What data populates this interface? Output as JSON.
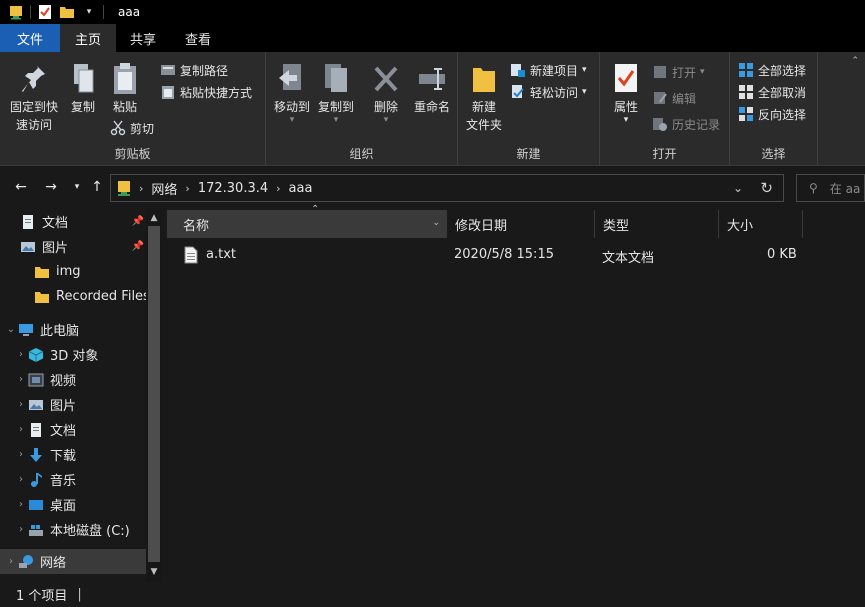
{
  "window": {
    "title": "aaa"
  },
  "tabs": [
    {
      "label": "文件"
    },
    {
      "label": "主页"
    },
    {
      "label": "共享"
    },
    {
      "label": "查看"
    }
  ],
  "ribbon": {
    "clipboard": {
      "label": "剪贴板",
      "pin_line1": "固定到快",
      "pin_line2": "速访问",
      "copy": "复制",
      "paste": "粘贴",
      "copy_path": "复制路径",
      "paste_shortcut": "粘贴快捷方式",
      "cut": "剪切"
    },
    "organize": {
      "label": "组织",
      "move_to": "移动到",
      "copy_to": "复制到",
      "delete": "删除",
      "rename": "重命名"
    },
    "new": {
      "label": "新建",
      "new_folder_line1": "新建",
      "new_folder_line2": "文件夹",
      "new_item": "新建项目",
      "easy_access": "轻松访问"
    },
    "open": {
      "label": "打开",
      "properties": "属性",
      "open": "打开",
      "edit": "编辑",
      "history": "历史记录"
    },
    "select": {
      "label": "选择",
      "select_all": "全部选择",
      "select_none": "全部取消",
      "invert": "反向选择"
    }
  },
  "address": {
    "crumbs": [
      "网络",
      "172.30.3.4",
      "aaa"
    ],
    "search_placeholder": "在 aa"
  },
  "nav": {
    "quick": [
      {
        "label": "文档",
        "icon": "document-icon",
        "pinned": true
      },
      {
        "label": "图片",
        "icon": "pictures-icon",
        "pinned": true
      },
      {
        "label": "img",
        "icon": "folder-icon",
        "pinned": false
      },
      {
        "label": "Recorded Files",
        "icon": "folder-icon",
        "pinned": false
      }
    ],
    "this_pc": "此电脑",
    "pc_items": [
      {
        "label": "3D 对象",
        "icon": "3d-objects-icon"
      },
      {
        "label": "视频",
        "icon": "videos-icon"
      },
      {
        "label": "图片",
        "icon": "pictures-icon"
      },
      {
        "label": "文档",
        "icon": "document-icon"
      },
      {
        "label": "下载",
        "icon": "download-icon"
      },
      {
        "label": "音乐",
        "icon": "music-icon"
      },
      {
        "label": "桌面",
        "icon": "desktop-icon"
      },
      {
        "label": "本地磁盘 (C:)",
        "icon": "drive-icon"
      }
    ],
    "network": "网络"
  },
  "columns": {
    "name": "名称",
    "date": "修改日期",
    "type": "类型",
    "size": "大小"
  },
  "files": [
    {
      "name": "a.txt",
      "date": "2020/5/8 15:15",
      "type": "文本文档",
      "size": "0 KB"
    }
  ],
  "status": {
    "count": "1 个项目"
  },
  "colors": {
    "accent": "#1a5fb4",
    "folder": "#f0c040",
    "background": "#191919",
    "ribbon": "#2b2b2b"
  }
}
